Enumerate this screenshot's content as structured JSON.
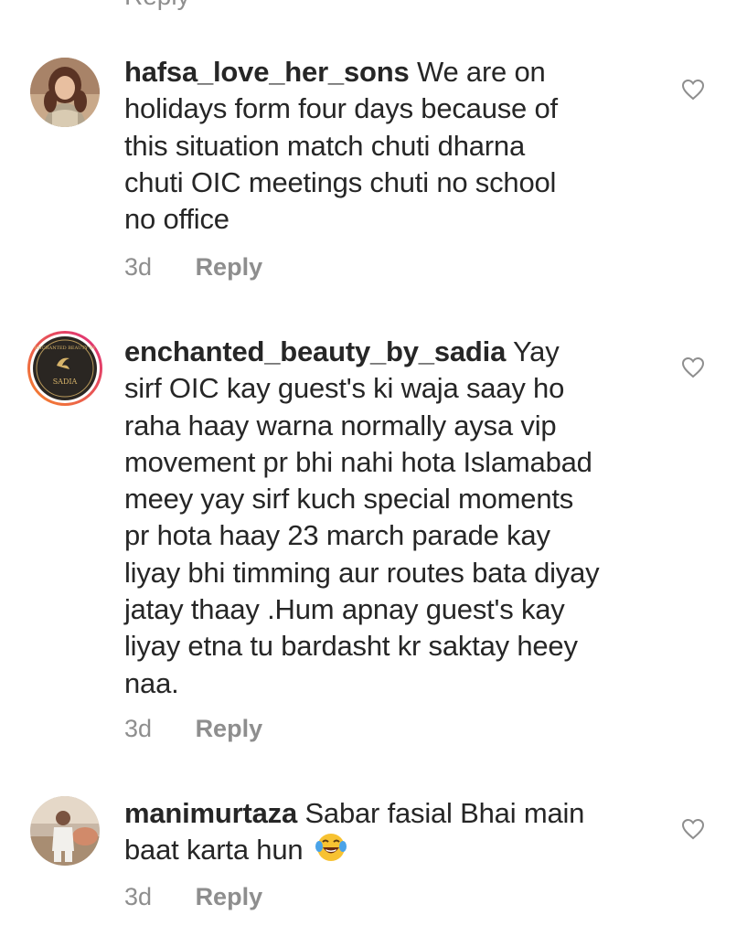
{
  "top_fragment": {
    "reply_label": "Reply"
  },
  "comments": [
    {
      "username": "hafsa_love_her_sons",
      "text": "We are on holidays form four days because of this situation match chuti dharna chuti  OIC meetings chuti no school no office",
      "lines": [
        "holidays form four days because of",
        "this situation match chuti dharna",
        "chuti  OIC meetings chuti no school",
        "no office"
      ],
      "first_line_rest": " We are on",
      "age": "3d",
      "reply_label": "Reply"
    },
    {
      "username": "enchanted_beauty_by_sadia",
      "avatar_text_top": "ENCHANTED BEAUTY BY",
      "avatar_text_bottom": "SADIA",
      "first_line_rest": " Yay",
      "lines": [
        "sirf OIC kay guest's ki waja saay ho",
        "raha haay warna normally aysa vip",
        "movement  pr bhi nahi hota Islamabad",
        "meey yay sirf kuch special moments",
        "pr hota haay 23 march parade kay",
        "liyay bhi timming aur routes bata diyay",
        "jatay thaay .Hum apnay guest's kay",
        "liyay etna tu bardasht kr saktay heey",
        "naa."
      ],
      "age": "3d",
      "reply_label": "Reply"
    },
    {
      "username": "manimurtaza",
      "first_line_rest": " Sabar fasial Bhai main",
      "lines": [
        "baat karta hun"
      ],
      "emoji": "face-with-tears-of-joy",
      "age": "3d",
      "reply_label": "Reply"
    }
  ],
  "icons": {
    "like": "heart-outline-icon"
  },
  "colors": {
    "text": "#262626",
    "muted": "#8e8e8e",
    "story_ring_start": "#f58529",
    "story_ring_end": "#dd2a7b"
  }
}
